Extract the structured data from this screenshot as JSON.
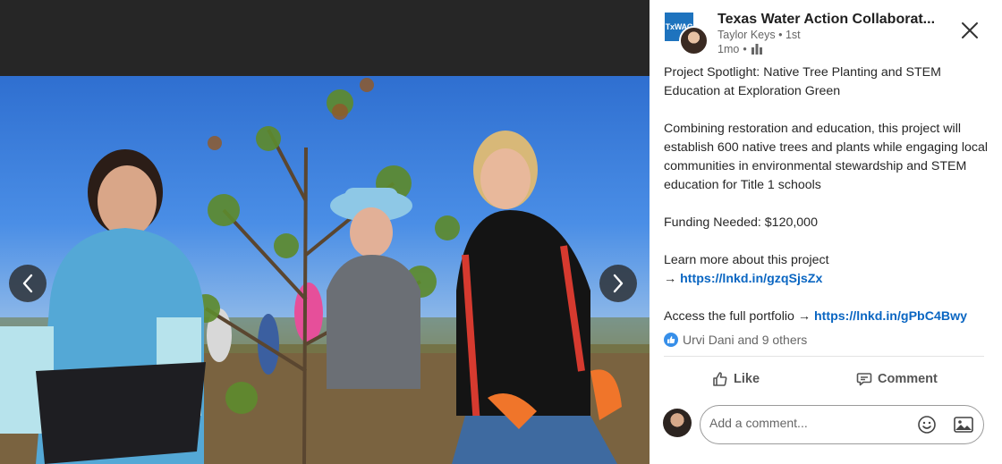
{
  "media": {
    "prev_icon": "chevron-left-icon",
    "next_icon": "chevron-right-icon"
  },
  "post": {
    "logo_text": "TxWAC",
    "company_name": "Texas Water Action Collaborat...",
    "author": "Taylor Keys",
    "connection": "1st",
    "time": "1mo",
    "visibility_icon": "company-visibility-icon",
    "body": {
      "title_line": "Project Spotlight: Native Tree Planting and STEM Education at Exploration Green",
      "description": "Combining restoration and education, this project will establish 600 native trees and plants while engaging local communities in environmental stewardship and STEM education for Title 1 schools",
      "funding": "Funding Needed: $120,000",
      "learn_more": "Learn more about this project",
      "learn_more_arrow": "→",
      "learn_more_link": "https://lnkd.in/gzqSjsZx",
      "portfolio_text": "Access the full portfolio →",
      "portfolio_link": "https://lnkd.in/gPbC4Bwy"
    },
    "reactions_text": "Urvi Dani and 9 others",
    "actions": {
      "like": "Like",
      "comment": "Comment"
    },
    "comment_placeholder": "Add a comment..."
  },
  "colors": {
    "link": "#0a66c2",
    "like_reaction": "#378fe9",
    "company_logo": "#1e73be"
  }
}
